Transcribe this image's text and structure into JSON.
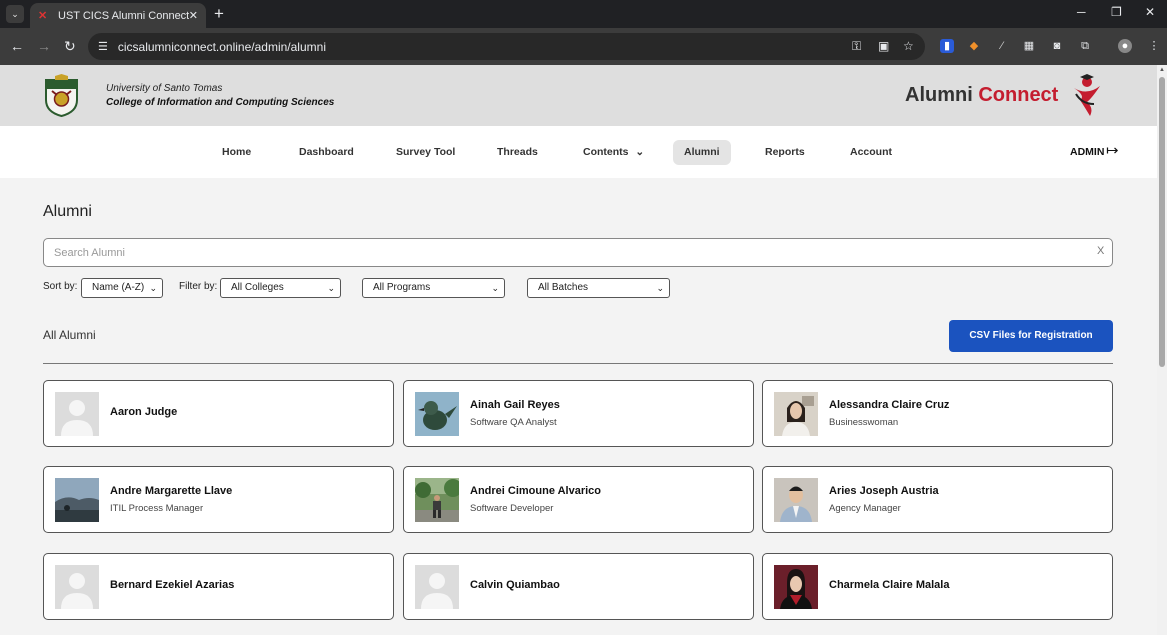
{
  "browser": {
    "tab_title": "UST CICS Alumni Connect",
    "url": "cicsalumniconnect.online/admin/alumni"
  },
  "header": {
    "university": "University of Santo Tomas",
    "college": "College of Information and Computing Sciences",
    "brand_main": "Alumni",
    "brand_accent": "Connect",
    "accent_color": "#c41d2f"
  },
  "nav": {
    "items": [
      "Home",
      "Dashboard",
      "Survey Tool",
      "Threads",
      "Contents",
      "Alumni",
      "Reports",
      "Account"
    ],
    "active": "Alumni",
    "admin_label": "ADMIN"
  },
  "main": {
    "title": "Alumni",
    "search_placeholder": "Search Alumni",
    "search_clear": "X",
    "sort_label": "Sort by:",
    "sort_value": "Name (A-Z)",
    "filter_label": "Filter by:",
    "college_value": "All Colleges",
    "program_value": "All Programs",
    "batch_value": "All Batches",
    "section_label": "All Alumni",
    "csv_button": "CSV Files for Registration",
    "button_color": "#1b53bf"
  },
  "alumni": [
    {
      "name": "Aaron Judge",
      "job": "",
      "photo": "placeholder"
    },
    {
      "name": "Ainah Gail Reyes",
      "job": "Software QA Analyst",
      "photo": "bird"
    },
    {
      "name": "Alessandra Claire Cruz",
      "job": "Businesswoman",
      "photo": "portrait-light"
    },
    {
      "name": "Andre Margarette Llave",
      "job": "ITIL Process Manager",
      "photo": "landscape"
    },
    {
      "name": "Andrei Cimoune Alvarico",
      "job": "Software Developer",
      "photo": "garden"
    },
    {
      "name": "Aries Joseph Austria",
      "job": "Agency Manager",
      "photo": "portrait-suit"
    },
    {
      "name": "Bernard Ezekiel Azarias",
      "job": "",
      "photo": "placeholder"
    },
    {
      "name": "Calvin Quiambao",
      "job": "",
      "photo": "placeholder"
    },
    {
      "name": "Charmela Claire Malala",
      "job": "",
      "photo": "portrait-grad"
    }
  ]
}
